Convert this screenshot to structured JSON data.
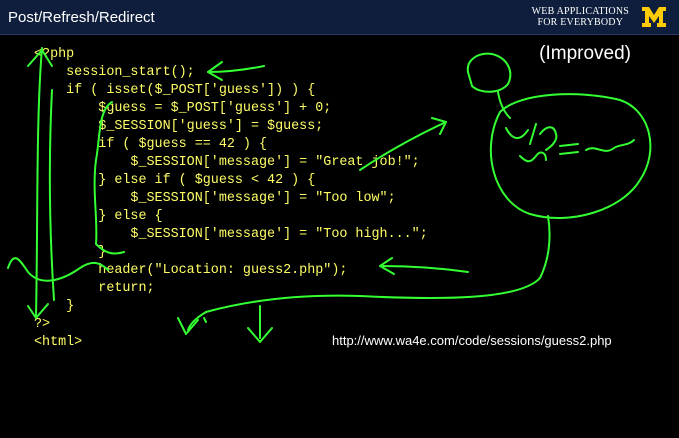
{
  "header": {
    "title": "Post/Refresh/Redirect",
    "brand_line1": "WEB APPLICATIONS",
    "brand_line2": "FOR EVERYBODY"
  },
  "subtitle": "(Improved)",
  "code_lines": [
    "<?php",
    "    session_start();",
    "    if ( isset($_POST['guess']) ) {",
    "        $guess = $_POST['guess'] + 0;",
    "        $_SESSION['guess'] = $guess;",
    "        if ( $guess == 42 ) {",
    "            $_SESSION['message'] = \"Great job!\";",
    "        } else if ( $guess < 42 ) {",
    "            $_SESSION['message'] = \"Too low\";",
    "        } else {",
    "            $_SESSION['message'] = \"Too high...\";",
    "        }",
    "        header(\"Location: guess2.php\");",
    "        return;",
    "    }",
    "?>",
    "<html>"
  ],
  "url": "http://www.wa4e.com/code/sessions/guess2.php",
  "colors": {
    "code": "#ffff66",
    "annotation": "#33ff33",
    "header_bg": "#0f1e3d",
    "logo": "#ffcb05"
  }
}
